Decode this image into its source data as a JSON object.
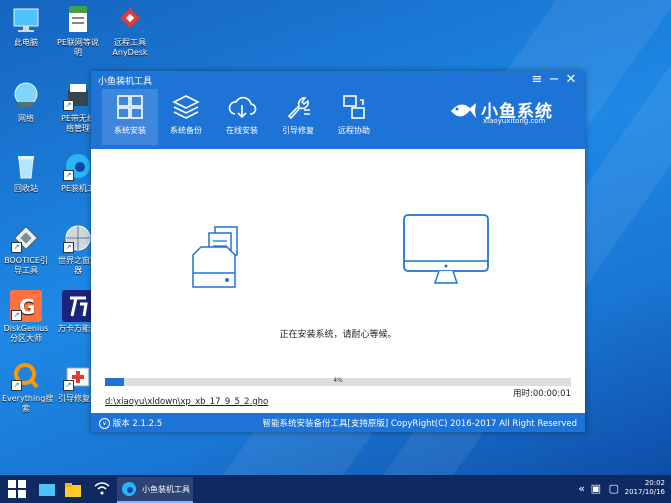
{
  "desktop": {
    "icons": [
      {
        "name": "desktop-icon-this-pc",
        "label": "此电脑"
      },
      {
        "name": "desktop-icon-pe-network",
        "label": "PE联网等说明"
      },
      {
        "name": "desktop-icon-anydesk",
        "label": "远程工具\nAnyDesk"
      },
      {
        "name": "desktop-icon-network",
        "label": "网络"
      },
      {
        "name": "desktop-icon-pe-wireless",
        "label": "PE带无线\n络管理"
      },
      {
        "name": "desktop-icon-recycle-bin",
        "label": "回收站"
      },
      {
        "name": "desktop-icon-pe-tool",
        "label": "PE装机工"
      },
      {
        "name": "desktop-icon-bootice",
        "label": "BOOTICE引\n导工具"
      },
      {
        "name": "desktop-icon-browser",
        "label": "世界之窗浏\n器"
      },
      {
        "name": "desktop-icon-diskgenius",
        "label": "DiskGenius\n分区大师"
      },
      {
        "name": "desktop-icon-universal-driver",
        "label": "万卡万能驱"
      },
      {
        "name": "desktop-icon-everything",
        "label": "Everything搜\n索"
      },
      {
        "name": "desktop-icon-boot-repair",
        "label": "引导修复工"
      }
    ]
  },
  "app": {
    "title": "小鱼装机工具",
    "window_controls": {
      "menu": "≡",
      "minimize": "−",
      "close": "✕"
    },
    "nav": [
      {
        "label": "系统安装",
        "icon": "windows-icon",
        "active": true
      },
      {
        "label": "系统备份",
        "icon": "layers-icon",
        "active": false
      },
      {
        "label": "在线安装",
        "icon": "cloud-download-icon",
        "active": false
      },
      {
        "label": "引导修复",
        "icon": "wrench-icon",
        "active": false
      },
      {
        "label": "远程协助",
        "icon": "remote-desktop-icon",
        "active": false
      }
    ],
    "brand": {
      "name": "小鱼系统",
      "url": "xiaoyuxitong.com"
    },
    "status": "正在安装系统，请耐心等候。",
    "progress": {
      "percent": 4,
      "label": "4%"
    },
    "elapsed": "用时:00:00:01",
    "file_path": "d:\\xiaoyu\\xldown\\xp_xb_17_9_5_2.gho",
    "footer": {
      "version": "版本 2.1.2.5",
      "copyright": "智能系统安装备份工具[支持原版]  CopyRight(C) 2016-2017 All Right Reserved"
    }
  },
  "taskbar": {
    "task": "小鱼装机工具",
    "clock": {
      "time": "20:02",
      "date": "2017/10/16"
    }
  },
  "colors": {
    "accent": "#1e73d6",
    "desktop": "#1976d2",
    "taskbar": "#0f2a63"
  }
}
